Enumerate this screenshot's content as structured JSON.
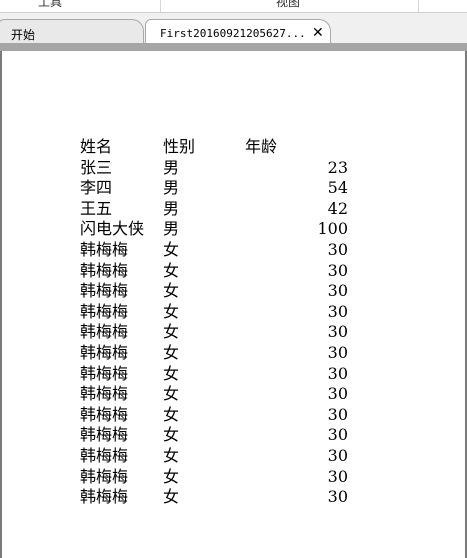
{
  "menu": {
    "tools": "工具",
    "view": "视图"
  },
  "tabs": [
    {
      "label": "开始"
    },
    {
      "label": "First20160921205627..."
    }
  ],
  "table": {
    "headers": [
      "姓名",
      "性别",
      "年龄"
    ],
    "rows": [
      [
        "张三",
        "男",
        "23"
      ],
      [
        "李四",
        "男",
        "54"
      ],
      [
        "王五",
        "男",
        "42"
      ],
      [
        "闪电大侠",
        "男",
        "100"
      ],
      [
        "韩梅梅",
        "女",
        "30"
      ],
      [
        "韩梅梅",
        "女",
        "30"
      ],
      [
        "韩梅梅",
        "女",
        "30"
      ],
      [
        "韩梅梅",
        "女",
        "30"
      ],
      [
        "韩梅梅",
        "女",
        "30"
      ],
      [
        "韩梅梅",
        "女",
        "30"
      ],
      [
        "韩梅梅",
        "女",
        "30"
      ],
      [
        "韩梅梅",
        "女",
        "30"
      ],
      [
        "韩梅梅",
        "女",
        "30"
      ],
      [
        "韩梅梅",
        "女",
        "30"
      ],
      [
        "韩梅梅",
        "女",
        "30"
      ],
      [
        "韩梅梅",
        "女",
        "30"
      ],
      [
        "韩梅梅",
        "女",
        "30"
      ]
    ]
  },
  "icons": {
    "tab_close": "close-icon"
  }
}
